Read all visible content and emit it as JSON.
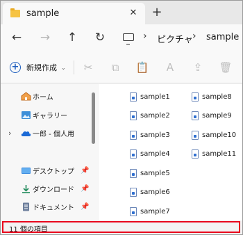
{
  "tab": {
    "title": "sample",
    "close_glyph": "✕",
    "new_glyph": "+"
  },
  "nav": {
    "back_glyph": "←",
    "forward_glyph": "→",
    "up_glyph": "↑",
    "refresh_glyph": "↻",
    "breadcrumbs": [
      "ピクチャ",
      "sample"
    ],
    "separator": "›"
  },
  "command_bar": {
    "new_label": "新規作成",
    "new_chevron": "⌄",
    "icons": [
      "cut-icon",
      "copy-icon",
      "paste-icon",
      "rename-icon",
      "share-icon",
      "delete-icon"
    ],
    "cut_glyph": "✂",
    "copy_glyph": "⧉",
    "paste_glyph": "📋",
    "rename_glyph": "Ａ",
    "share_glyph": "⇪",
    "delete_glyph": "🗑"
  },
  "sidebar": {
    "items": [
      {
        "label": "ホーム",
        "icon": "home-icon"
      },
      {
        "label": "ギャラリー",
        "icon": "gallery-icon"
      },
      {
        "label": "一郎 - 個人用",
        "icon": "onedrive-icon",
        "expandable": true
      },
      {
        "label": "デスクトップ",
        "icon": "desktop-icon",
        "pinned": true
      },
      {
        "label": "ダウンロード",
        "icon": "download-icon",
        "pinned": true
      },
      {
        "label": "ドキュメント",
        "icon": "documents-icon",
        "pinned": true
      }
    ],
    "chevron_glyph": "›",
    "pin_glyph": "📌"
  },
  "files": {
    "column1": [
      "sample1",
      "sample2",
      "sample3",
      "sample4",
      "sample5",
      "sample6",
      "sample7"
    ],
    "column2": [
      "sample8",
      "sample9",
      "sample10",
      "sample11"
    ]
  },
  "status": {
    "item_count": "11 個の項目"
  },
  "colors": {
    "highlight": "#e8001c",
    "accent": "#1f5fbf",
    "folder": "#f6c343"
  }
}
